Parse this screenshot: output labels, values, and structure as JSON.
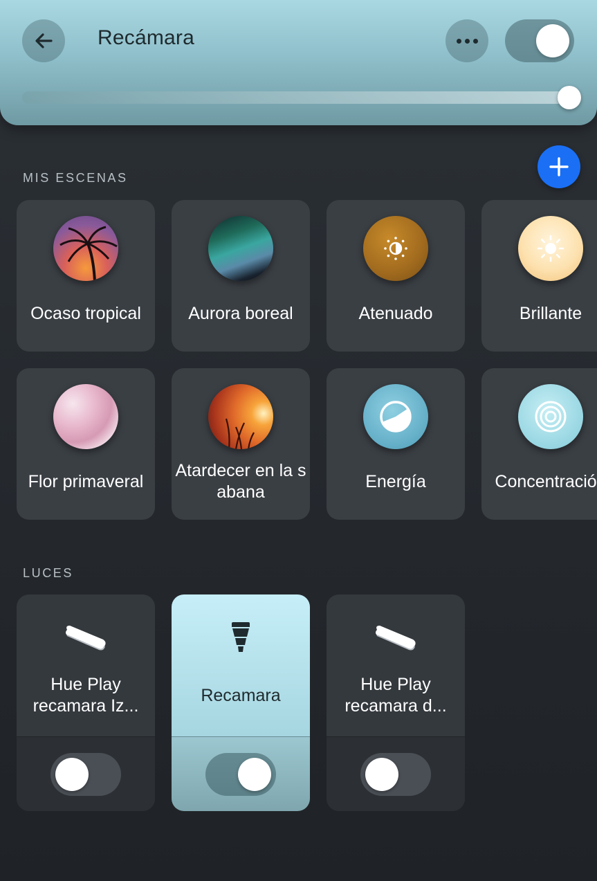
{
  "header": {
    "title": "Recámara",
    "master_on": true,
    "brightness_fraction": 1.0
  },
  "scenes_section": {
    "label": "MIS ESCENAS",
    "add_icon": "plus-icon",
    "items": [
      {
        "name": "Ocaso tropical",
        "thumb": "tropical-sunset-image"
      },
      {
        "name": "Aurora boreal",
        "thumb": "aurora-image"
      },
      {
        "name": "Atenuado",
        "thumb": "dim-sun-icon"
      },
      {
        "name": "Brillante",
        "thumb": "bright-sun-icon"
      },
      {
        "name": "Flor primaveral",
        "thumb": "spring-blossom-image"
      },
      {
        "name": "Atardecer en la sabana",
        "thumb": "savanna-sunset-image"
      },
      {
        "name": "Energía",
        "thumb": "energize-icon"
      },
      {
        "name": "Concentración",
        "thumb": "concentrate-icon"
      }
    ]
  },
  "lights_section": {
    "label": "LUCES",
    "items": [
      {
        "name": "Hue Play recamara Iz...",
        "icon": "light-bar-icon",
        "on": false
      },
      {
        "name": "Recamara",
        "icon": "bulb-icon",
        "on": true
      },
      {
        "name": "Hue Play recamara d...",
        "icon": "light-bar-icon",
        "on": false
      }
    ]
  },
  "colors": {
    "accent_blue": "#1a6ff5",
    "header_tint": "#a9d8e2",
    "active_card": "#c6eef8"
  }
}
